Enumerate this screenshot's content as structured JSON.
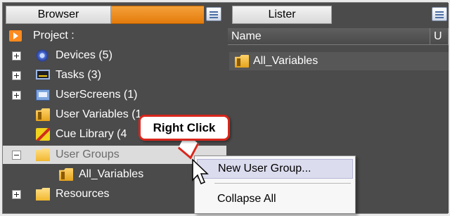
{
  "browser": {
    "title": "Browser",
    "accent_color": "#e8840f",
    "tree": [
      {
        "label": "Project :",
        "icon": "project-icon",
        "expander": "none"
      },
      {
        "label": "Devices (5)",
        "icon": "devices-icon",
        "expander": "plus"
      },
      {
        "label": "Tasks (3)",
        "icon": "tasks-icon",
        "expander": "plus"
      },
      {
        "label": "UserScreens (1)",
        "icon": "user-screens-icon",
        "expander": "plus"
      },
      {
        "label": "User Variables (1",
        "icon": "user-variables-icon",
        "expander": "none"
      },
      {
        "label": "Cue Library (4",
        "icon": "cue-library-icon",
        "expander": "none"
      },
      {
        "label": "User Groups",
        "icon": "folder-icon",
        "expander": "minus"
      },
      {
        "label": "All_Variables",
        "icon": "variables-folder-icon",
        "expander": "none"
      },
      {
        "label": "Resources",
        "icon": "folder-icon",
        "expander": "plus"
      }
    ]
  },
  "lister": {
    "title": "Lister",
    "columns": [
      "Name",
      "U"
    ],
    "rows": [
      {
        "name": "All_Variables",
        "icon": "variables-folder-icon"
      }
    ]
  },
  "callout": {
    "text": "Right Click",
    "border_color": "#d9261c"
  },
  "context_menu": {
    "items": [
      {
        "label": "New User Group...",
        "highlighted": true
      },
      {
        "label": "Collapse All",
        "highlighted": false
      }
    ]
  }
}
